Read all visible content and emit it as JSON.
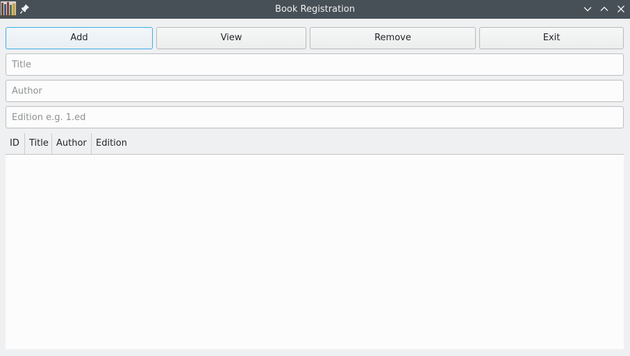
{
  "window": {
    "title": "Book Registration",
    "app_icon": "bookshelf-icon",
    "pin_icon": "pin-icon",
    "controls": [
      "minimize-icon",
      "maximize-icon",
      "close-icon"
    ]
  },
  "toolbar": {
    "add_label": "Add",
    "view_label": "View",
    "remove_label": "Remove",
    "exit_label": "Exit"
  },
  "form": {
    "title_placeholder": "Title",
    "title_value": "",
    "author_placeholder": "Author",
    "author_value": "",
    "edition_placeholder": "Edition e.g. 1.ed",
    "edition_value": ""
  },
  "table": {
    "columns": [
      "ID",
      "Title",
      "Author",
      "Edition"
    ],
    "rows": []
  },
  "colors": {
    "titlebar": "#475057",
    "focus_accent": "#3daee9",
    "window_bg": "#eff0f1"
  }
}
